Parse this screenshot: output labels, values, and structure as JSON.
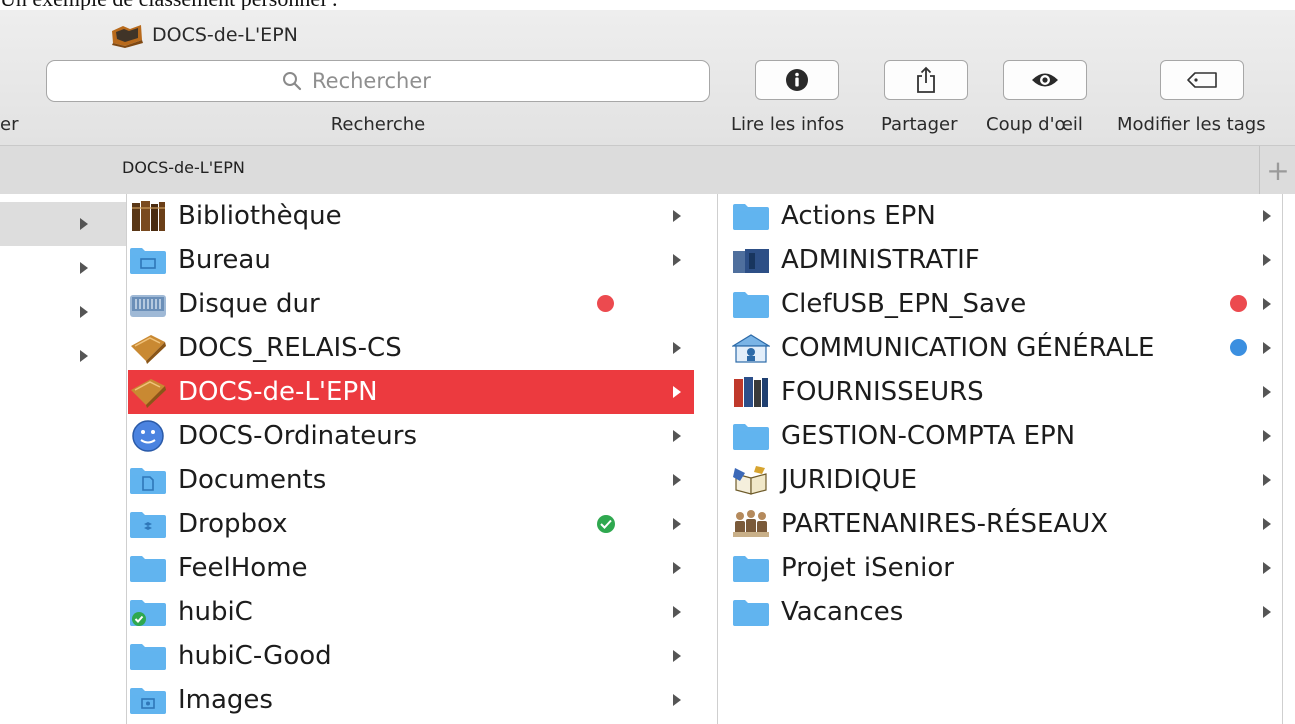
{
  "caption": "Un exemple de classement personnel :",
  "window": {
    "title": "DOCS-de-L'EPN",
    "left_cut_label": "er",
    "search": {
      "placeholder": "Rechercher",
      "label": "Recherche"
    },
    "toolbar": [
      {
        "label": "Lire les infos",
        "icon": "info-icon"
      },
      {
        "label": "Partager",
        "icon": "share-icon"
      },
      {
        "label": "Coup d'œil",
        "icon": "eye-icon"
      },
      {
        "label": "Modifier les tags",
        "icon": "tag-icon"
      }
    ]
  },
  "tab": {
    "title": "DOCS-de-L'EPN",
    "add": "+"
  },
  "colors": {
    "selection": "#ec3a3f",
    "tag_red": "#ec4a4f",
    "tag_blue": "#3b8fe0",
    "tag_green": "#2fa84f",
    "folder_blue": "#62b4ef"
  },
  "column1": [
    {
      "label": "Bibliothèque",
      "icon": "library-books-icon",
      "tag": null,
      "selected": false
    },
    {
      "label": "Bureau",
      "icon": "desktop-folder-icon",
      "tag": null,
      "selected": false
    },
    {
      "label": "Disque dur",
      "icon": "hard-disk-icon",
      "tag": "red",
      "selected": false
    },
    {
      "label": "DOCS_RELAIS-CS",
      "icon": "custom-folder-icon",
      "tag": null,
      "selected": false
    },
    {
      "label": "DOCS-de-L'EPN",
      "icon": "custom-folder-icon",
      "tag": null,
      "selected": true
    },
    {
      "label": "DOCS-Ordinateurs",
      "icon": "finder-face-icon",
      "tag": null,
      "selected": false
    },
    {
      "label": "Documents",
      "icon": "documents-folder-icon",
      "tag": null,
      "selected": false
    },
    {
      "label": "Dropbox",
      "icon": "dropbox-folder-icon",
      "tag": "green-check",
      "selected": false
    },
    {
      "label": "FeelHome",
      "icon": "folder-icon",
      "tag": null,
      "selected": false
    },
    {
      "label": "hubiC",
      "icon": "hubic-folder-icon",
      "tag": null,
      "selected": false
    },
    {
      "label": "hubiC-Good",
      "icon": "folder-icon",
      "tag": null,
      "selected": false
    },
    {
      "label": "Images",
      "icon": "pictures-folder-icon",
      "tag": null,
      "selected": false
    }
  ],
  "column2": [
    {
      "label": "Actions EPN",
      "icon": "folder-icon",
      "tag": null
    },
    {
      "label": "ADMINISTRATIF",
      "icon": "binder-icon",
      "tag": null
    },
    {
      "label": "ClefUSB_EPN_Save",
      "icon": "folder-icon",
      "tag": "red"
    },
    {
      "label": "COMMUNICATION GÉNÉRALE",
      "icon": "communication-icon",
      "tag": "blue"
    },
    {
      "label": "FOURNISSEURS",
      "icon": "binders-icon",
      "tag": null
    },
    {
      "label": "GESTION-COMPTA EPN",
      "icon": "folder-icon",
      "tag": null
    },
    {
      "label": "JURIDIQUE",
      "icon": "legal-book-icon",
      "tag": null
    },
    {
      "label": "PARTENANIRES-RÉSEAUX",
      "icon": "partners-icon",
      "tag": null
    },
    {
      "label": "Projet iSenior",
      "icon": "folder-icon",
      "tag": null
    },
    {
      "label": "Vacances",
      "icon": "folder-icon",
      "tag": null
    }
  ]
}
